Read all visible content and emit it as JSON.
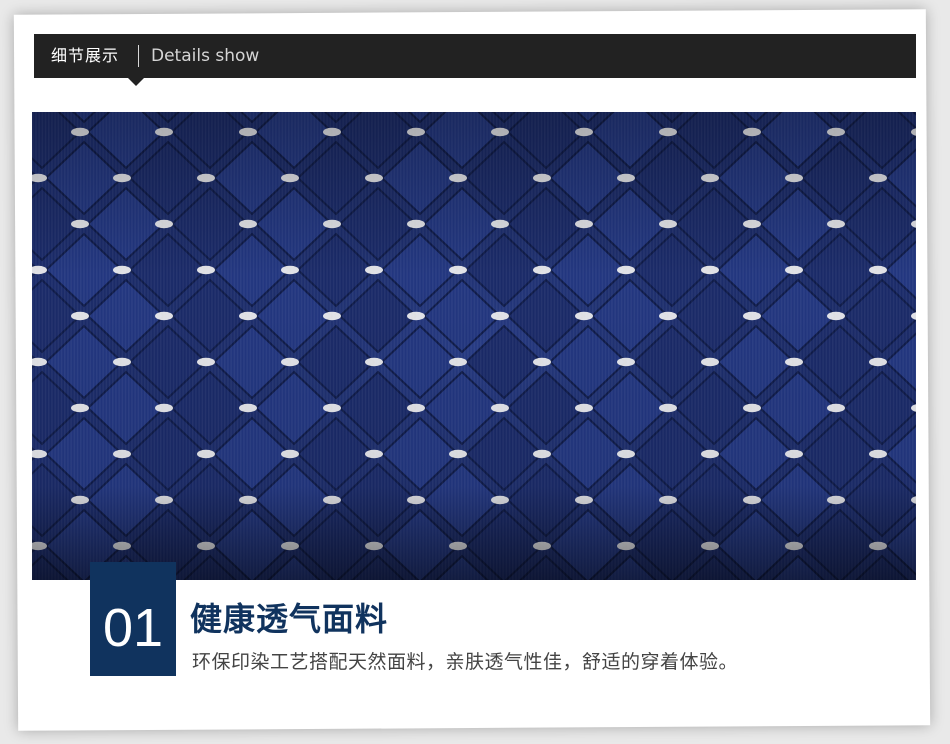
{
  "header": {
    "title_cn": "细节展示",
    "title_en": "Details show"
  },
  "image": {
    "icon": "mesh-fabric-closeup",
    "colors": {
      "fabric": "#1a2b6e",
      "holes": "#f2f2f2"
    }
  },
  "feature": {
    "number": "01",
    "title": "健康透气面料",
    "description": "环保印染工艺搭配天然面料，亲肤透气性佳，舒适的穿着体验。"
  },
  "colors": {
    "header_bar": "#222222",
    "accent": "#10335e"
  }
}
